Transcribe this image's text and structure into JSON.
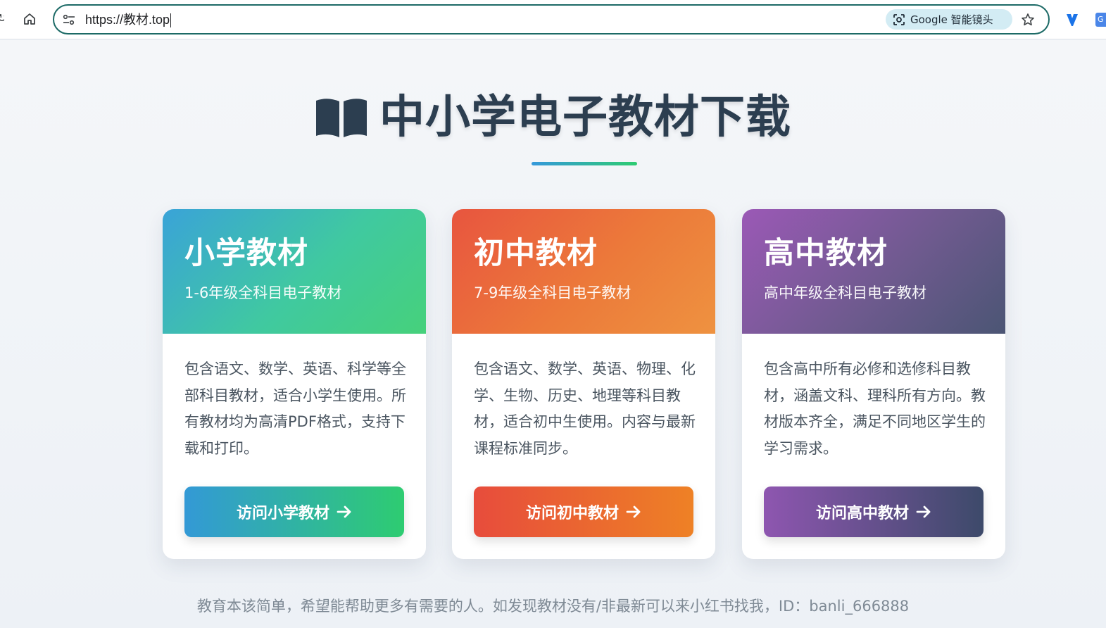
{
  "browser": {
    "url": "https://教材.top",
    "lens_label": "Google 智能镜头",
    "ext_fragment": "G"
  },
  "page": {
    "title": "中小学电子教材下载",
    "title_icon": "open-book-icon",
    "footer": "教育本该简单，希望能帮助更多有需要的人。如发现教材没有/非最新可以来小红书找我，ID：banli_666888"
  },
  "cards": [
    {
      "title": "小学教材",
      "subtitle": "1-6年级全科目电子教材",
      "description": "包含语文、数学、英语、科学等全部科目教材，适合小学生使用。所有教材均为高清PDF格式，支持下载和打印。",
      "button": "访问小学教材",
      "colors": [
        "#3498db",
        "#2ecc71"
      ]
    },
    {
      "title": "初中教材",
      "subtitle": "7-9年级全科目电子教材",
      "description": "包含语文、数学、英语、物理、化学、生物、历史、地理等科目教材，适合初中生使用。内容与最新课程标准同步。",
      "button": "访问初中教材",
      "colors": [
        "#e74c3c",
        "#f39c12"
      ]
    },
    {
      "title": "高中教材",
      "subtitle": "高中年级全科目电子教材",
      "description": "包含高中所有必修和选修科目教材，涵盖文科、理科所有方向。教材版本齐全，满足不同地区学生的学习需求。",
      "button": "访问高中教材",
      "colors": [
        "#9b59b6",
        "#34495e"
      ]
    }
  ]
}
